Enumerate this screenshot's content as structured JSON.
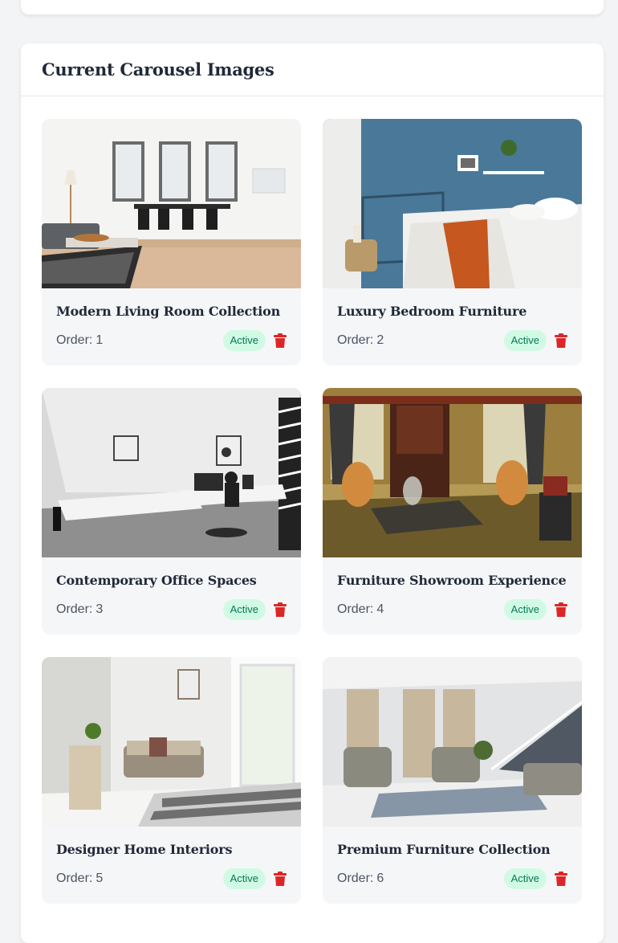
{
  "section": {
    "title": "Current Carousel Images"
  },
  "cards": [
    {
      "title": "Modern Living Room Collection",
      "order_label": "Order:",
      "order": "1",
      "status": "Active",
      "icon": "trash-icon"
    },
    {
      "title": "Luxury Bedroom Furniture",
      "order_label": "Order:",
      "order": "2",
      "status": "Active",
      "icon": "trash-icon"
    },
    {
      "title": "Contemporary Office Spaces",
      "order_label": "Order:",
      "order": "3",
      "status": "Active",
      "icon": "trash-icon"
    },
    {
      "title": "Furniture Showroom Experience",
      "order_label": "Order:",
      "order": "4",
      "status": "Active",
      "icon": "trash-icon"
    },
    {
      "title": "Designer Home Interiors",
      "order_label": "Order:",
      "order": "5",
      "status": "Active",
      "icon": "trash-icon"
    },
    {
      "title": "Premium Furniture Collection",
      "order_label": "Order:",
      "order": "6",
      "status": "Active",
      "icon": "trash-icon"
    }
  ],
  "colors": {
    "active_badge_bg": "#d1fae5",
    "active_badge_text": "#047857",
    "delete_icon": "#dc2626"
  }
}
